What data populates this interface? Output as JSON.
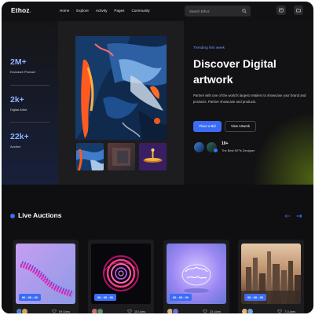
{
  "brand": {
    "name": "Ethoz",
    "dot": "."
  },
  "nav": {
    "items": [
      "Home",
      "Explore",
      "Activity",
      "Pages",
      "Community"
    ],
    "search_placeholder": "Search Ethoz"
  },
  "icons": {
    "search": "search-icon",
    "wallet": "wallet-icon",
    "folder": "folder-icon",
    "heart": "heart-icon",
    "arrows": [
      "arrow-left-icon",
      "arrow-right-icon"
    ]
  },
  "stats": [
    {
      "value": "2M+",
      "label": "Exclusive Product"
    },
    {
      "value": "2k+",
      "label": "Digital Artist"
    },
    {
      "value": "22k+",
      "label": "Auction"
    }
  ],
  "hero": {
    "eyebrow": "Trending this week",
    "title": "Discover Digital artwork",
    "description": "Partner with one of the world's largest retailers to showcase your brand and products. Partner showcase and products.",
    "primary_button": "Place a Bid",
    "secondary_button": "View Artwork",
    "artists_count": "10+",
    "artists_label": "The Best NFTs Designer"
  },
  "auctions": {
    "title": "Live Auctions",
    "cards": [
      {
        "timer": "00 : 00 : 00",
        "likes": "09 Likes"
      },
      {
        "timer": "00 : 00 : 00",
        "likes": "15 Likes"
      },
      {
        "timer": "00 : 00 : 00",
        "likes": "23 Likes"
      },
      {
        "timer": "00 : 00 : 00",
        "likes": "71 Likes"
      }
    ]
  },
  "colors": {
    "accent": "#3b6cf6",
    "background": "#111113",
    "stat_value": "#8fb2ff"
  }
}
